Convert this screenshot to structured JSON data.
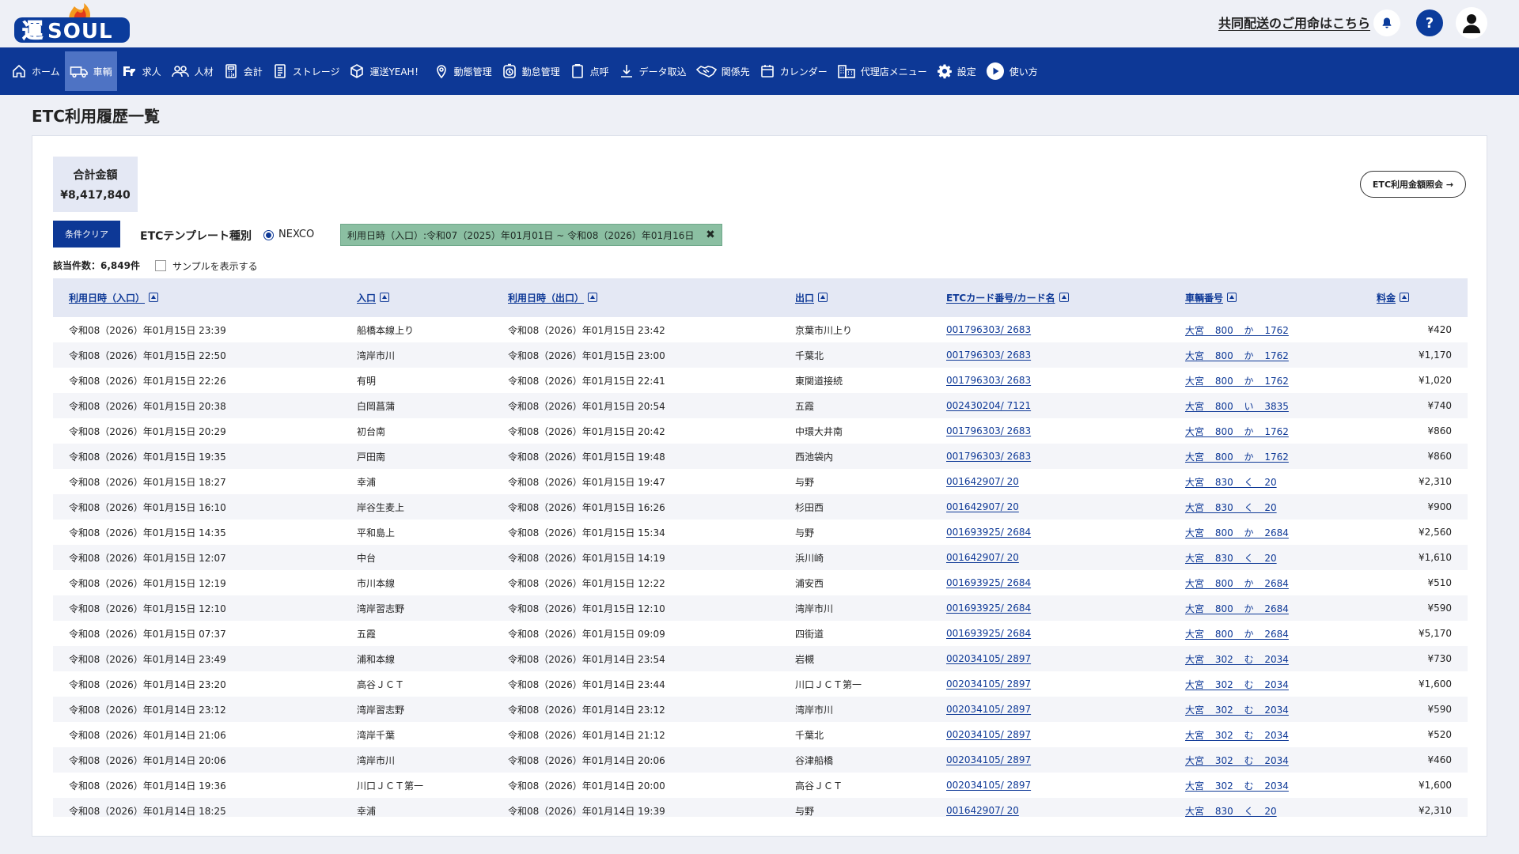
{
  "header": {
    "logo_text": "運SOUL",
    "link": "共同配送のご用命はこちら",
    "help_label": "?"
  },
  "nav": [
    {
      "label": "ホーム",
      "icon": "home-icon"
    },
    {
      "label": "車輌",
      "icon": "truck-icon"
    },
    {
      "label": "求人",
      "icon": "job-icon"
    },
    {
      "label": "人材",
      "icon": "people-icon"
    },
    {
      "label": "会計",
      "icon": "calculator-icon"
    },
    {
      "label": "ストレージ",
      "icon": "storage-icon"
    },
    {
      "label": "運送YEAH！",
      "icon": "box-icon"
    },
    {
      "label": "動態管理",
      "icon": "location-pin-icon"
    },
    {
      "label": "勤怠管理",
      "icon": "stopwatch-icon"
    },
    {
      "label": "点呼",
      "icon": "clipboard-icon"
    },
    {
      "label": "データ取込",
      "icon": "download-icon"
    },
    {
      "label": "関係先",
      "icon": "handshake-icon"
    },
    {
      "label": "カレンダー",
      "icon": "calendar-icon"
    },
    {
      "label": "代理店メニュー",
      "icon": "agency-icon"
    },
    {
      "label": "設定",
      "icon": "gear-icon"
    },
    {
      "label": "使い方",
      "icon": "play-icon"
    }
  ],
  "page": {
    "title": "ETC利用履歴一覧",
    "total_label": "合計金額",
    "total_value": "¥8,417,840",
    "etc_button": "ETC利用金額照会 →",
    "clear_button": "条件クリア",
    "template_label": "ETCテンプレート種別",
    "radio_label": "NEXCO",
    "filter_chip": "利用日時（入口）:令和07（2025）年01月01日 ~ 令和08（2026）年01月16日",
    "count": "該当件数：6,849件",
    "sample_label": "サンプルを表示する"
  },
  "table": {
    "columns": [
      "利用日時（入口）",
      "入口",
      "利用日時（出口）",
      "出口",
      "ETCカード番号/カード名",
      "車輌番号",
      "料金"
    ],
    "rows": [
      [
        "令和08（2026）年01月15日 23:39",
        "船橋本線上り",
        "令和08（2026）年01月15日 23:42",
        "京葉市川上り",
        "001796303/ 2683",
        "大宮 800 か 1762",
        "¥420"
      ],
      [
        "令和08（2026）年01月15日 22:50",
        "湾岸市川",
        "令和08（2026）年01月15日 23:00",
        "千葉北",
        "001796303/ 2683",
        "大宮 800 か 1762",
        "¥1,170"
      ],
      [
        "令和08（2026）年01月15日 22:26",
        "有明",
        "令和08（2026）年01月15日 22:41",
        "東関道接続",
        "001796303/ 2683",
        "大宮 800 か 1762",
        "¥1,020"
      ],
      [
        "令和08（2026）年01月15日 20:38",
        "白岡菖蒲",
        "令和08（2026）年01月15日 20:54",
        "五霞",
        "002430204/ 7121",
        "大宮 800 い 3835",
        "¥740"
      ],
      [
        "令和08（2026）年01月15日 20:29",
        "初台南",
        "令和08（2026）年01月15日 20:42",
        "中環大井南",
        "001796303/ 2683",
        "大宮 800 か 1762",
        "¥860"
      ],
      [
        "令和08（2026）年01月15日 19:35",
        "戸田南",
        "令和08（2026）年01月15日 19:48",
        "西池袋内",
        "001796303/ 2683",
        "大宮 800 か 1762",
        "¥860"
      ],
      [
        "令和08（2026）年01月15日 18:27",
        "幸浦",
        "令和08（2026）年01月15日 19:47",
        "与野",
        "001642907/ 20",
        "大宮 830 く 20",
        "¥2,310"
      ],
      [
        "令和08（2026）年01月15日 16:10",
        "岸谷生麦上",
        "令和08（2026）年01月15日 16:26",
        "杉田西",
        "001642907/ 20",
        "大宮 830 く 20",
        "¥900"
      ],
      [
        "令和08（2026）年01月15日 14:35",
        "平和島上",
        "令和08（2026）年01月15日 15:34",
        "与野",
        "001693925/ 2684",
        "大宮 800 か 2684",
        "¥2,560"
      ],
      [
        "令和08（2026）年01月15日 12:07",
        "中台",
        "令和08（2026）年01月15日 14:19",
        "浜川崎",
        "001642907/ 20",
        "大宮 830 く 20",
        "¥1,610"
      ],
      [
        "令和08（2026）年01月15日 12:19",
        "市川本線",
        "令和08（2026）年01月15日 12:22",
        "浦安西",
        "001693925/ 2684",
        "大宮 800 か 2684",
        "¥510"
      ],
      [
        "令和08（2026）年01月15日 12:10",
        "湾岸習志野",
        "令和08（2026）年01月15日 12:10",
        "湾岸市川",
        "001693925/ 2684",
        "大宮 800 か 2684",
        "¥590"
      ],
      [
        "令和08（2026）年01月15日 07:37",
        "五霞",
        "令和08（2026）年01月15日 09:09",
        "四街道",
        "001693925/ 2684",
        "大宮 800 か 2684",
        "¥5,170"
      ],
      [
        "令和08（2026）年01月14日 23:49",
        "浦和本線",
        "令和08（2026）年01月14日 23:54",
        "岩槻",
        "002034105/ 2897",
        "大宮 302 む 2034",
        "¥730"
      ],
      [
        "令和08（2026）年01月14日 23:20",
        "高谷ＪＣＴ",
        "令和08（2026）年01月14日 23:44",
        "川口ＪＣＴ第一",
        "002034105/ 2897",
        "大宮 302 む 2034",
        "¥1,600"
      ],
      [
        "令和08（2026）年01月14日 23:12",
        "湾岸習志野",
        "令和08（2026）年01月14日 23:12",
        "湾岸市川",
        "002034105/ 2897",
        "大宮 302 む 2034",
        "¥590"
      ],
      [
        "令和08（2026）年01月14日 21:06",
        "湾岸千葉",
        "令和08（2026）年01月14日 21:12",
        "千葉北",
        "002034105/ 2897",
        "大宮 302 む 2034",
        "¥520"
      ],
      [
        "令和08（2026）年01月14日 20:06",
        "湾岸市川",
        "令和08（2026）年01月14日 20:06",
        "谷津船橋",
        "002034105/ 2897",
        "大宮 302 む 2034",
        "¥460"
      ],
      [
        "令和08（2026）年01月14日 19:36",
        "川口ＪＣＴ第一",
        "令和08（2026）年01月14日 20:00",
        "高谷ＪＣＴ",
        "002034105/ 2897",
        "大宮 302 む 2034",
        "¥1,600"
      ],
      [
        "令和08（2026）年01月14日 18:25",
        "幸浦",
        "令和08（2026）年01月14日 19:39",
        "与野",
        "001642907/ 20",
        "大宮 830 く 20",
        "¥2,310"
      ]
    ]
  }
}
